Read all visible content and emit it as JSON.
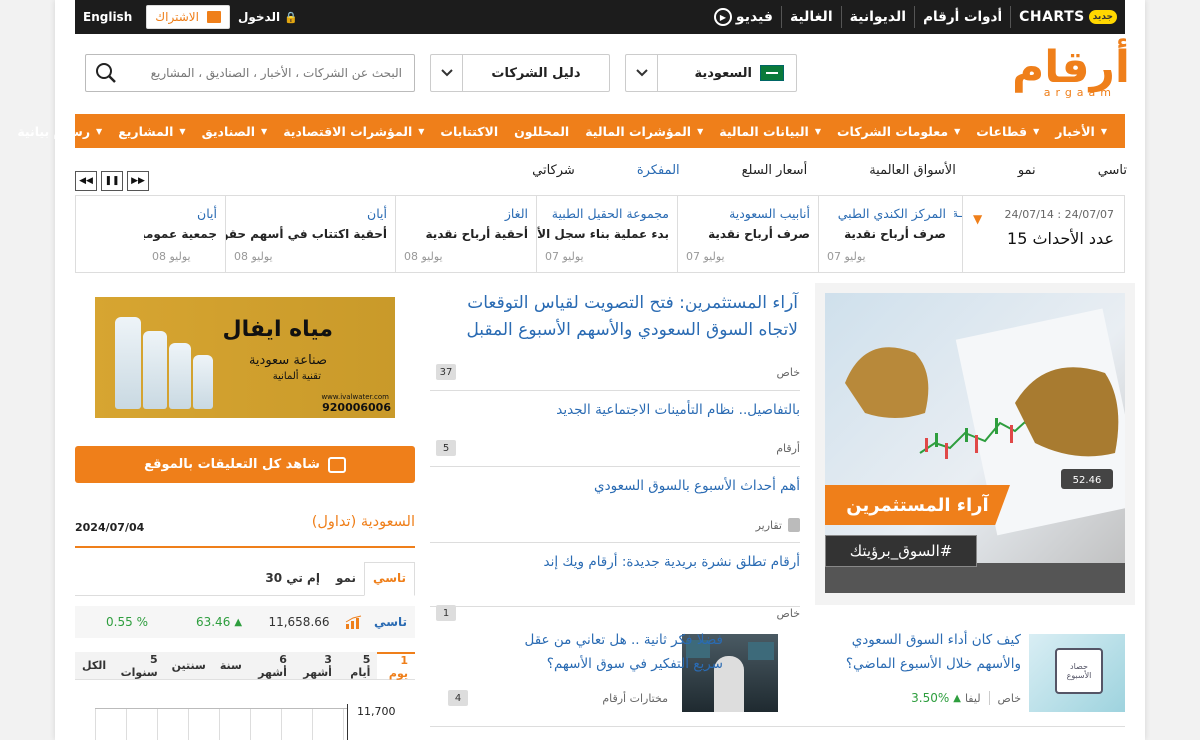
{
  "topbar": {
    "charts_label": "CHARTS",
    "new_badge": "جديد",
    "tools": "أدوات أرقام",
    "diwaniya": "الديوانية",
    "ghaliya": "الغالية",
    "video": "فيديو",
    "english": "English",
    "login": "الدخول",
    "subscribe": "الاشتراك"
  },
  "logo": {
    "ar": "أرقام",
    "en": "argaam"
  },
  "selectors": {
    "country": "السعودية",
    "companies": "دليل الشركات"
  },
  "search": {
    "placeholder": "البحث عن الشركات ، الأخبار ، الصناديق ، المشاريع"
  },
  "nav": [
    "الأخبار",
    "قطاعات",
    "معلومات الشركات",
    "البيانات المالية",
    "المؤشرات المالية",
    "المحللون",
    "الاكتتابات",
    "المؤشرات الاقتصادية",
    "الصناديق",
    "المشاريع",
    "رسوم بيانية"
  ],
  "nav_carets": [
    true,
    true,
    true,
    true,
    true,
    false,
    false,
    true,
    true,
    true,
    true
  ],
  "subnav": [
    "تاسي",
    "نمو",
    "الأسواق العالمية",
    "أسعار السلع",
    "المفكرة",
    "شركاتي"
  ],
  "subnav_active": 4,
  "events": {
    "dates": "24/07/14 : 24/07/07",
    "count_label": "عدد الأحداث 15"
  },
  "ticker": [
    {
      "company": "المركز الكندي الطبي",
      "text": "صرف أرباح نقدية",
      "date": "07 يوليو"
    },
    {
      "company": "أنابيب السعودية",
      "text": "صرف أرباح نقدية",
      "date": "07 يوليو"
    },
    {
      "company": "مجموعة الحقيل الطبية",
      "text": "بدء عملية بناء سجل الأوامر",
      "date": "07 يوليو"
    },
    {
      "company": "الغاز",
      "text": "أحقية أرباح نقدية",
      "date": "08 يوليو"
    },
    {
      "company": "أيان",
      "text": "أحقية اكتتاب في أسهم حقو...",
      "date": "08 يوليو"
    },
    {
      "company": "أيان",
      "text": "جمعية عمومية",
      "date": "08 يوليو"
    }
  ],
  "hero": {
    "line1": "آراء المستثمرين",
    "line2": "#السوق_برؤيتك",
    "chart_badge": "52.46"
  },
  "articles": [
    {
      "title": "آراء المستثمرين: فتح التصويت لقياس التوقعات لاتجاه السوق السعودي والأسهم الأسبوع المقبل",
      "source": "خاص",
      "comments": "37"
    },
    {
      "title": "بالتفاصيل.. نظام التأمينات الاجتماعية الجديد",
      "source": "أرقام",
      "comments": "5"
    },
    {
      "title": "أهم أحداث الأسبوع بالسوق السعودي",
      "source": "تقارير",
      "comments": ""
    },
    {
      "title": "أرقام تطلق نشرة بريدية جديدة: أرقام ويك إند",
      "source": "خاص",
      "comments": "1"
    }
  ],
  "ad": {
    "brand": "مياه ايفال",
    "line1": "صناعة سعودية",
    "line2": "تقنية ألمانية",
    "site": "www.ivalwater.com",
    "phone": "920006006"
  },
  "comments_button": "شاهد كل التعليقات بالموقع",
  "market": {
    "title": "السعودية (تداول)",
    "date": "2024/07/04",
    "tabs": [
      "تاسي",
      "نمو",
      "إم تي 30"
    ],
    "active_tab": 0,
    "index": "تاسي",
    "value": "11,658.66",
    "change": "63.46",
    "pct": "0.55 %",
    "periods": [
      "1 يوم",
      "5 أيام",
      "3 أشهر",
      "6 أشهر",
      "سنة",
      "سنتين",
      "5 سنوات",
      "الكل"
    ],
    "active_period": 0,
    "chart_tick": "11,700"
  },
  "bottom": [
    {
      "title": "كيف كان أداء السوق السعودي والأسهم خلال الأسبوع الماضي؟",
      "source": "خاص",
      "tag": "ليفا",
      "tag_change": "3.50%",
      "comments": "3",
      "thumb_label": "حصاد الأسبوع"
    },
    {
      "title": "فضلا فكر ثانية .. هل تعاني من عقل سريع التفكير في سوق الأسهم؟",
      "source": "مختارات أرقام",
      "comments": "4"
    }
  ],
  "colors": {
    "orange": "#ef7f1a",
    "blue": "#2a6bb3",
    "green": "#2e9e3e",
    "dark": "#1c1c1c"
  }
}
